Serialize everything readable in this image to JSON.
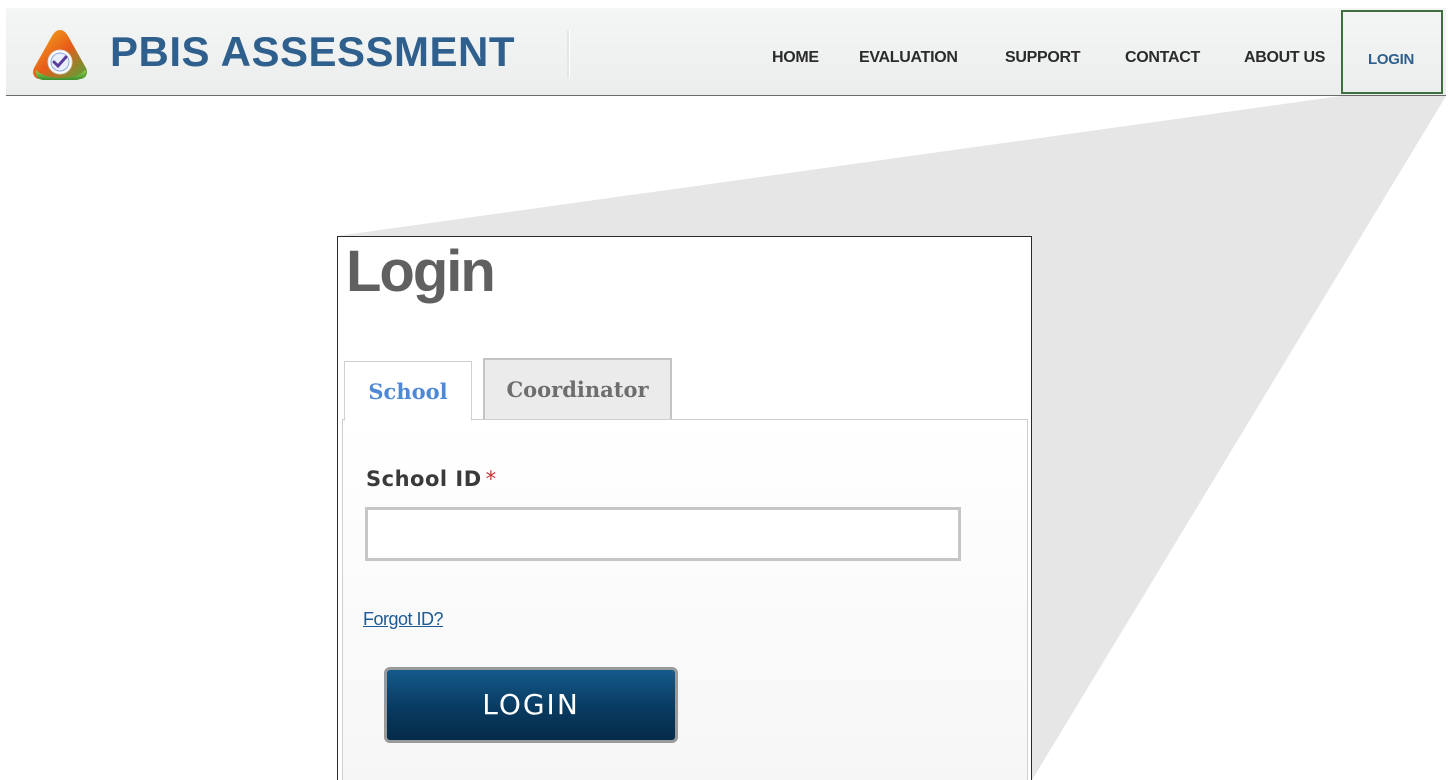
{
  "header": {
    "brand": "PBIS ASSESSMENT",
    "nav": [
      {
        "label": "HOME"
      },
      {
        "label": "EVALUATION"
      },
      {
        "label": "SUPPORT"
      },
      {
        "label": "CONTACT"
      },
      {
        "label": "ABOUT US"
      },
      {
        "label": "LOGIN"
      }
    ]
  },
  "login": {
    "title": "Login",
    "tabs": [
      {
        "label": "School",
        "active": true
      },
      {
        "label": "Coordinator",
        "active": false
      }
    ],
    "field_label": "School ID",
    "required_marker": "*",
    "field_value": "",
    "forgot_link": "Forgot ID?",
    "submit_label": "LOGIN"
  },
  "colors": {
    "brand": "#2f5f8d",
    "active_tab": "#4e89d6",
    "button": "#083a60",
    "highlight_border": "#3f6e3f"
  }
}
